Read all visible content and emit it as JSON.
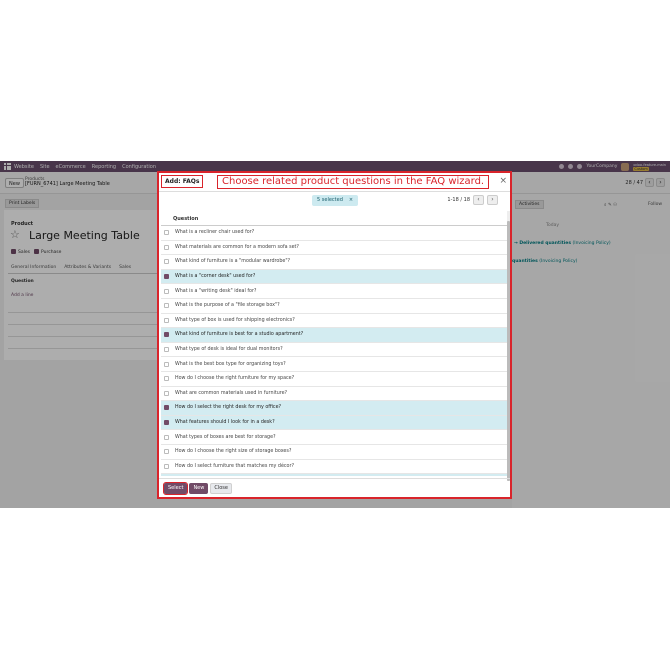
{
  "navbar": {
    "menus": [
      "Website",
      "Site",
      "eCommerce",
      "Reporting",
      "Configuration"
    ],
    "company": "YourCompany",
    "db_line1": "odoo-feature-main",
    "db_tag": "Custom"
  },
  "control": {
    "new_label": "New",
    "breadcrumb_parent": "Products",
    "breadcrumb_record": "[FURN_6741] Large Meeting Table",
    "pager": "28 / 47"
  },
  "form": {
    "print_labels": "Print Labels",
    "product_label": "Product",
    "product_name": "Large Meeting Table",
    "sales_label": "Sales",
    "purchase_label": "Purchase",
    "tabs": [
      "General Information",
      "Attributes & Variants",
      "Sales"
    ],
    "question_header": "Question",
    "add_line": "Add a line"
  },
  "chatter": {
    "activities": "Activities",
    "follow": "Follow",
    "today": "Today",
    "line1_value": "→ Delivered quantities",
    "line1_note": "(Invoicing Policy)",
    "line2_value": "quantities",
    "line2_note": "(Invoicing Policy)"
  },
  "modal": {
    "title": "Add: FAQs",
    "annotation": "Choose related product questions in the FAQ wizard.",
    "close_symbol": "×",
    "selected_text": "5 selected",
    "selected_clear": "×",
    "pager": "1-18 / 18",
    "column_header": "Question",
    "rows": [
      {
        "text": "What is a recliner chair used for?",
        "selected": false
      },
      {
        "text": "What materials are common for a modern sofa set?",
        "selected": false
      },
      {
        "text": "What kind of furniture is a \"modular wardrobe\"?",
        "selected": false
      },
      {
        "text": "What is a \"corner desk\" used for?",
        "selected": true
      },
      {
        "text": "What is a \"writing desk\" ideal for?",
        "selected": false
      },
      {
        "text": "What is the purpose of a \"file storage box\"?",
        "selected": false
      },
      {
        "text": "What type of box is used for shipping electronics?",
        "selected": false
      },
      {
        "text": "What kind of furniture is best for a studio apartment?",
        "selected": true
      },
      {
        "text": "What type of desk is ideal for dual monitors?",
        "selected": false
      },
      {
        "text": "What is the best box type for organizing toys?",
        "selected": false
      },
      {
        "text": "How do I choose the right furniture for my space?",
        "selected": false
      },
      {
        "text": "What are common materials used in furniture?",
        "selected": false
      },
      {
        "text": "How do I select the right desk for my office?",
        "selected": true
      },
      {
        "text": "What features should I look for in a desk?",
        "selected": true
      },
      {
        "text": "What types of boxes are best for storage?",
        "selected": false
      },
      {
        "text": "How do I choose the right size of storage boxes?",
        "selected": false
      },
      {
        "text": "How do I select furniture that matches my décor?",
        "selected": false
      },
      {
        "text": "",
        "selected": true
      }
    ],
    "buttons": {
      "select": "Select",
      "new": "New",
      "close": "Close"
    }
  },
  "colors": {
    "brand": "#714b67",
    "annotation_red": "#d9242b",
    "selected_row": "#d3ecf1"
  }
}
